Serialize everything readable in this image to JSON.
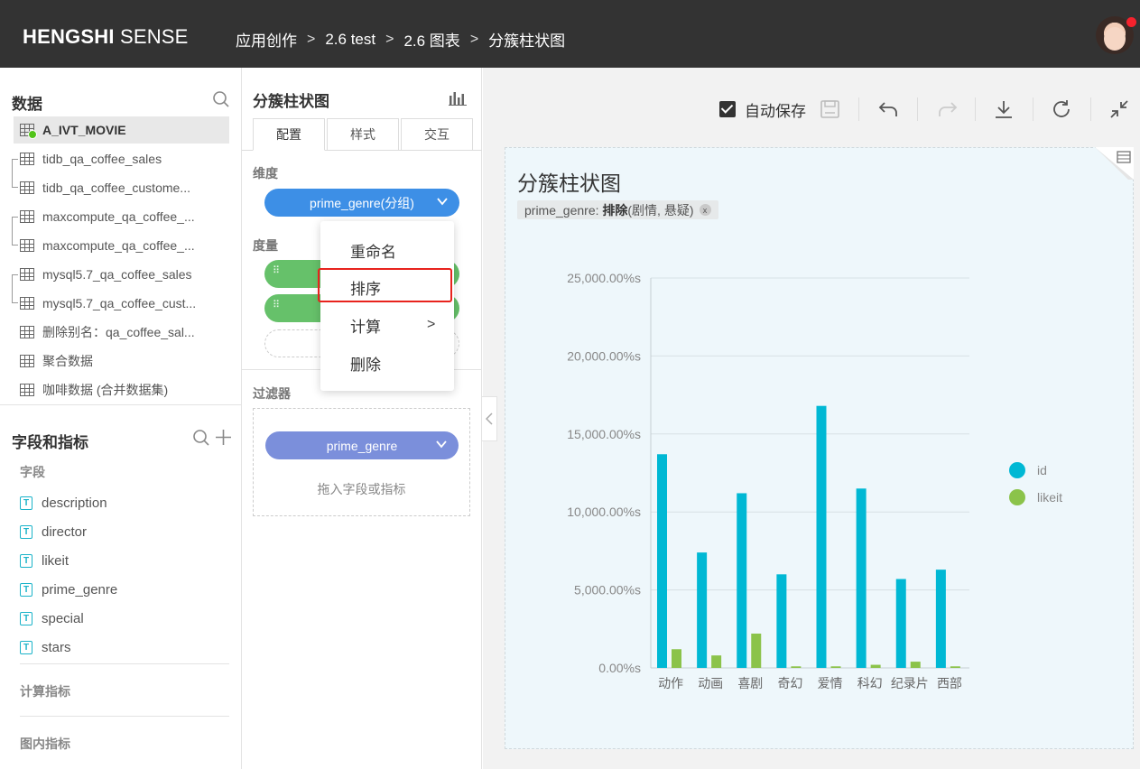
{
  "topbar": {
    "brand_bold": "HENGSHI",
    "brand_rest": " SENSE",
    "breadcrumbs": [
      "应用创作",
      "2.6 test",
      "2.6 图表",
      "分簇柱状图"
    ],
    "separator": ">"
  },
  "data_panel": {
    "title": "数据",
    "datasets": [
      {
        "label": "A_IVT_MOVIE",
        "active": true
      },
      {
        "label": "tidb_qa_coffee_sales"
      },
      {
        "label": "tidb_qa_coffee_custome..."
      },
      {
        "label": "maxcompute_qa_coffee_..."
      },
      {
        "label": "maxcompute_qa_coffee_..."
      },
      {
        "label": "mysql5.7_qa_coffee_sales"
      },
      {
        "label": "mysql5.7_qa_coffee_cust..."
      },
      {
        "label": "删除别名：qa_coffee_sal..."
      },
      {
        "label": "聚合数据"
      },
      {
        "label": "咖啡数据 (合并数据集)"
      }
    ]
  },
  "fields_panel": {
    "title": "字段和指标",
    "fields_label": "字段",
    "fields": [
      "description",
      "director",
      "likeit",
      "prime_genre",
      "special",
      "stars"
    ],
    "field_type_icon": "T",
    "calc_label": "计算指标",
    "inchart_label": "图内指标"
  },
  "config_panel": {
    "title": "分簇柱状图",
    "tabs": [
      "配置",
      "样式",
      "交互"
    ],
    "dimension_label": "维度",
    "dimension_pill": "prime_genre(分组)",
    "measure_label": "度量",
    "filter_label": "过滤器",
    "filter_pill": "prime_genre",
    "filter_hint": "拖入字段或指标"
  },
  "context_menu": {
    "items": [
      "重命名",
      "排序",
      "计算",
      "删除"
    ],
    "highlighted": "排序",
    "submenu_arrow": ">"
  },
  "toolbar": {
    "autosave_label": "自动保存",
    "autosave_checked": true
  },
  "chart_card": {
    "title": "分簇柱状图",
    "filter_field": "prime_genre:",
    "filter_op": "排除",
    "filter_values": "(剧情, 悬疑)",
    "filter_close": "x"
  },
  "chart_data": {
    "type": "bar",
    "categories": [
      "动作",
      "动画",
      "喜剧",
      "奇幻",
      "爱情",
      "科幻",
      "纪录片",
      "西部"
    ],
    "series": [
      {
        "name": "id",
        "color": "#00b8d4",
        "values": [
          13700,
          7400,
          11200,
          6000,
          16800,
          11500,
          5700,
          6300
        ]
      },
      {
        "name": "likeit",
        "color": "#8bc34a",
        "values": [
          1200,
          800,
          2200,
          100,
          100,
          200,
          400,
          100
        ]
      }
    ],
    "yticks": [
      "0.00%s",
      "5,000.00%s",
      "10,000.00%s",
      "15,000.00%s",
      "20,000.00%s",
      "25,000.00%s"
    ],
    "ylim": [
      0,
      25000
    ],
    "grid": true,
    "legend_position": "right"
  }
}
